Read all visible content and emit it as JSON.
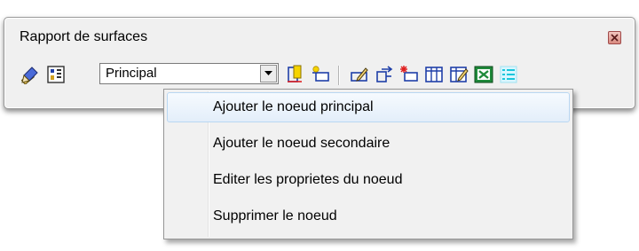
{
  "window": {
    "title": "Rapport de surfaces",
    "close_icon": "close-icon"
  },
  "toolbar": {
    "combo": {
      "value": "Principal"
    },
    "icons": [
      "surface-tool-icon",
      "grid-view-icon",
      "dropdown-arrow-icon",
      "add-main-node-icon",
      "add-sub-node-icon",
      "edit-node-icon",
      "move-node-icon",
      "delete-node-icon",
      "table-columns-icon",
      "edit-table-icon",
      "excel-export-icon",
      "list-report-icon"
    ]
  },
  "context_menu": {
    "items": [
      {
        "label": "Ajouter le noeud principal",
        "hovered": true
      },
      {
        "label": "Ajouter le noeud secondaire",
        "hovered": false
      },
      {
        "label": "Editer les proprietes du noeud",
        "hovered": false
      },
      {
        "label": "Supprimer le noeud",
        "hovered": false
      }
    ]
  },
  "colors": {
    "window_bg": "#f0f0f0",
    "hover_border": "#b9d7f2",
    "excel_green": "#1e8a3a",
    "delete_red": "#e02020",
    "add_yellow": "#f5d400",
    "icon_blue": "#1f3fa8"
  }
}
